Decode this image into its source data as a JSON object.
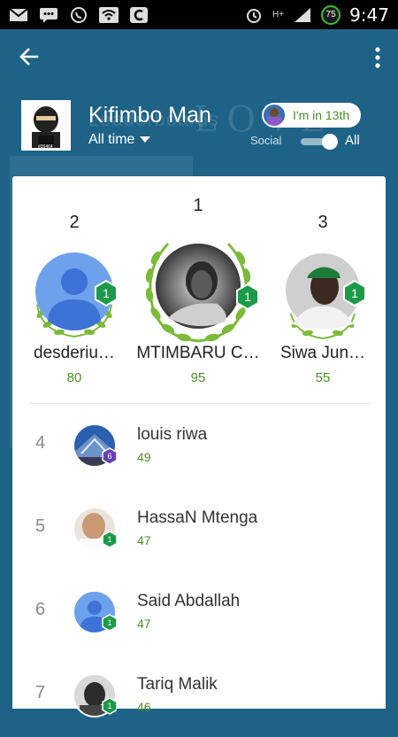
{
  "status_bar": {
    "time": "9:47",
    "network": "H+",
    "battery": "75"
  },
  "header": {
    "watermark_left": "Leaderboards",
    "watermark_right": "LOVE"
  },
  "player": {
    "name": "Kifimbo Man",
    "timeframe": "All time",
    "rank_pill": "I'm in 13th",
    "avatar_tag": "#26464"
  },
  "filter": {
    "social_label": "Social",
    "all_label": "All",
    "all_selected": true
  },
  "podium": [
    {
      "rank": "2",
      "name": "desderiu…",
      "score": "80",
      "level": "1"
    },
    {
      "rank": "1",
      "name": "MTIMBARU C…",
      "score": "95",
      "level": "1"
    },
    {
      "rank": "3",
      "name": "Siwa Jun…",
      "score": "55",
      "level": "1"
    }
  ],
  "list": [
    {
      "rank": "4",
      "name": "louis riwa",
      "score": "49",
      "level": "6",
      "badge_color": "#6a3fb5"
    },
    {
      "rank": "5",
      "name": "HassaN Mtenga",
      "score": "47",
      "level": "1",
      "badge_color": "#1b9a4a"
    },
    {
      "rank": "6",
      "name": "Said Abdallah",
      "score": "47",
      "level": "1",
      "badge_color": "#1b9a4a"
    },
    {
      "rank": "7",
      "name": "Tariq Malik",
      "score": "46",
      "level": "1",
      "badge_color": "#1b9a4a"
    }
  ],
  "colors": {
    "app_bar": "#1e6287",
    "score_green": "#4a8f24",
    "level_badge": "#1b9a4a",
    "laurel": "#7cba3a"
  },
  "icons": {
    "back": "arrow-left-icon",
    "menu": "more-vertical-icon"
  }
}
